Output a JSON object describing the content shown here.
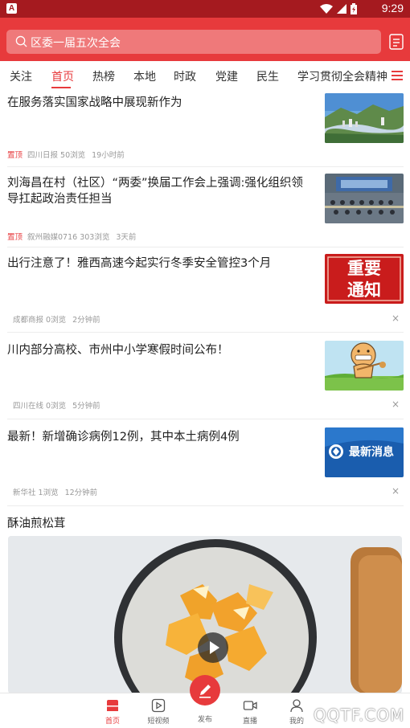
{
  "status_bar": {
    "app_badge": "A",
    "time": "9:29"
  },
  "search": {
    "query": "区委一届五次全会"
  },
  "tabs": [
    {
      "label": "关注"
    },
    {
      "label": "首页"
    },
    {
      "label": "热榜"
    },
    {
      "label": "本地"
    },
    {
      "label": "时政"
    },
    {
      "label": "党建"
    },
    {
      "label": "民生"
    },
    {
      "label": "学习贯彻全会精神"
    }
  ],
  "articles": [
    {
      "title": "在服务落实国家战略中展现新作为",
      "pin": "置顶",
      "source": "四川日报 50浏览",
      "time": "19小时前"
    },
    {
      "title": "刘海昌在村（社区）“两委”换届工作会上强调:强化组织领导扛起政治责任担当",
      "pin": "置顶",
      "source": "叙州融媒0716 303浏览",
      "time": "3天前"
    },
    {
      "title": "出行注意了！雅西高速今起实行冬季安全管控3个月",
      "source": "成都商报 0浏览",
      "time": "2分钟前",
      "thumb_text": [
        "重要",
        "通知"
      ]
    },
    {
      "title": "川内部分高校、市州中小学寒假时间公布！",
      "source": "四川在线 0浏览",
      "time": "5分钟前"
    },
    {
      "title": "最新！新增确诊病例12例，其中本土病例4例",
      "source": "新华社 1浏览",
      "time": "12分钟前",
      "thumb_text": "最新消息"
    }
  ],
  "close_glyph": "×",
  "video": {
    "title": "酥油煎松茸"
  },
  "bottom_nav": [
    {
      "label": "首页"
    },
    {
      "label": "短视频"
    },
    {
      "label": "发布"
    },
    {
      "label": "直播"
    },
    {
      "label": "我的"
    }
  ],
  "watermark": "QQTF.COM",
  "colors": {
    "brand_red": "#e73a3c",
    "status_bar": "#a51a1f",
    "text_muted": "#999999"
  }
}
